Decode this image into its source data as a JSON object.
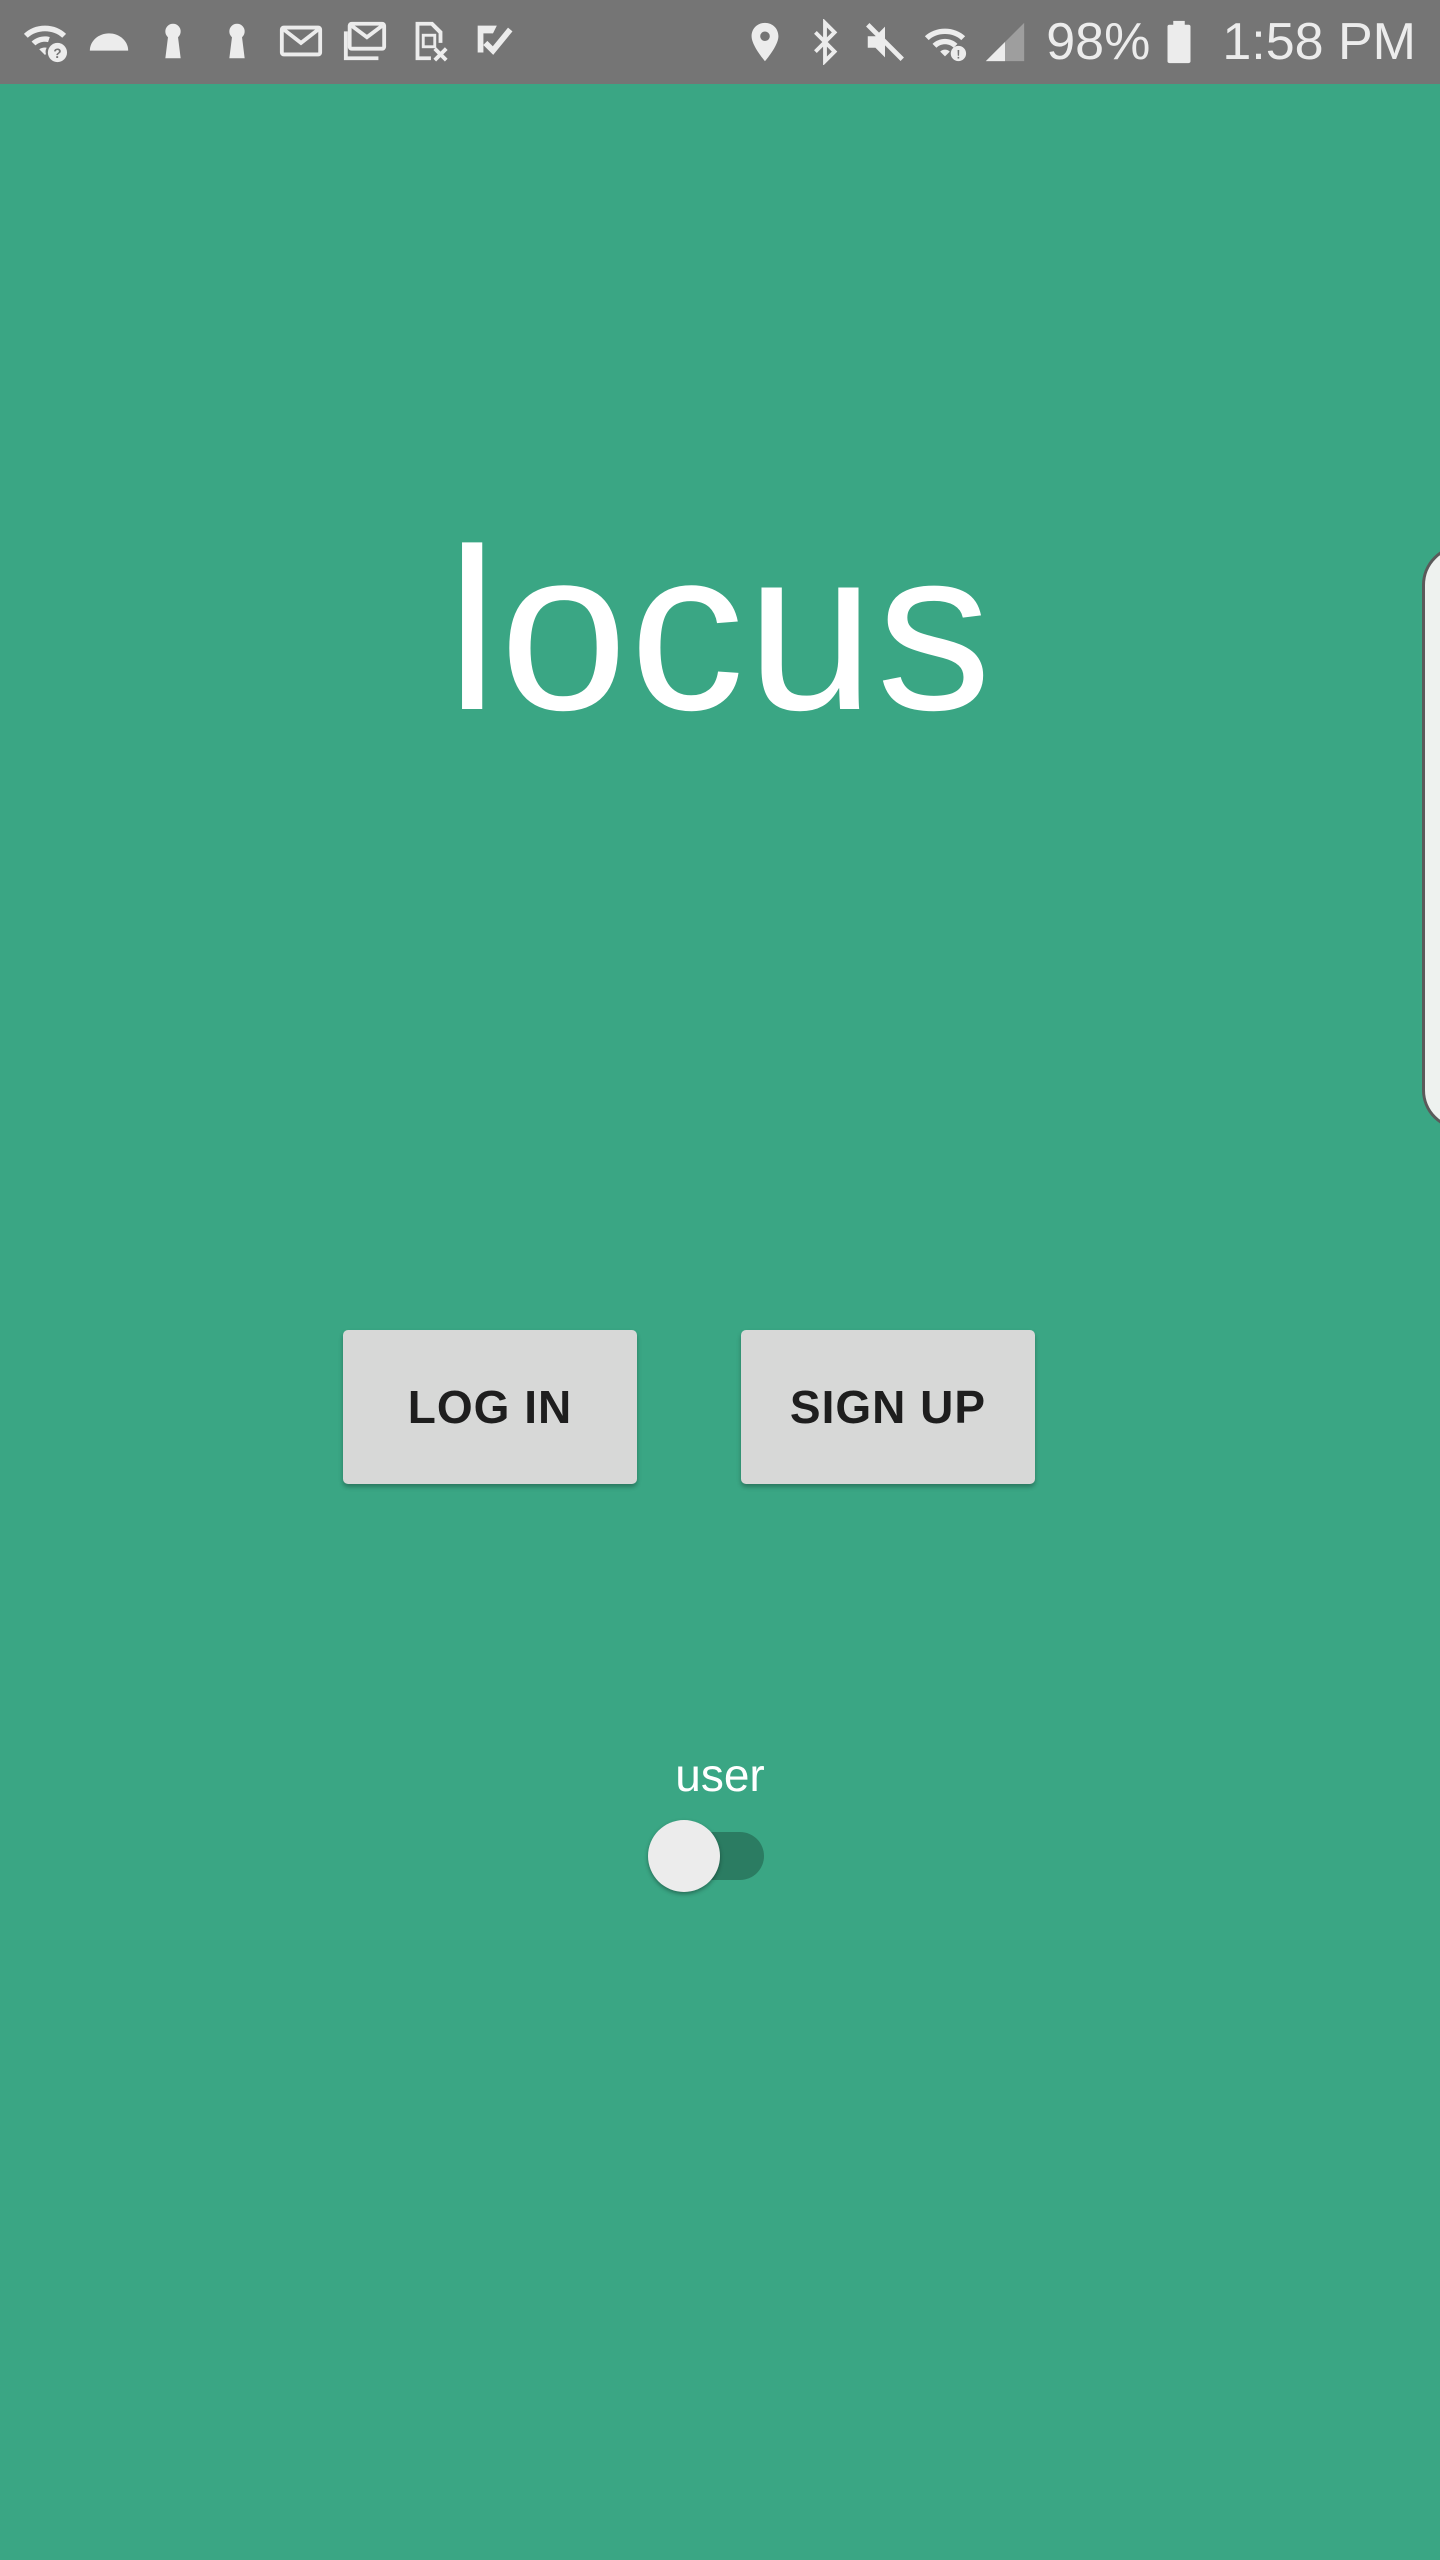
{
  "status_bar": {
    "left_icons": [
      "wifi-question-icon",
      "cloud-icon",
      "keyhole-icon",
      "keyhole-icon",
      "gmail-icon",
      "gmail-stack-icon",
      "sim-error-icon",
      "check-icon"
    ],
    "right_icons": [
      "location-icon",
      "bluetooth-icon",
      "mute-icon",
      "wifi-icon",
      "signal-icon",
      "battery-icon"
    ],
    "battery_percent": "98%",
    "time": "1:58 PM",
    "background": "#757575"
  },
  "app": {
    "title": "locus",
    "background": "#3aa684"
  },
  "buttons": {
    "login_label": "LOG IN",
    "signup_label": "SIGN UP"
  },
  "toggle": {
    "label": "user",
    "checked": false
  }
}
